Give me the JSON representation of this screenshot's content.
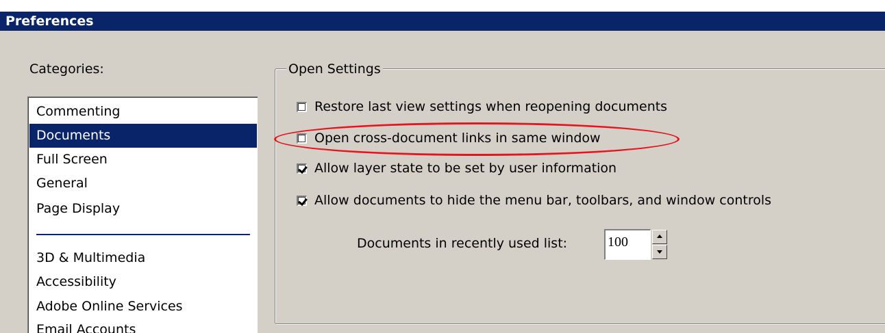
{
  "window": {
    "title": "Preferences"
  },
  "categories": {
    "label": "Categories:",
    "group1": [
      "Commenting",
      "Documents",
      "Full Screen",
      "General",
      "Page Display"
    ],
    "group2": [
      "3D & Multimedia",
      "Accessibility",
      "Adobe Online Services",
      "Email Accounts"
    ],
    "selected": "Documents"
  },
  "open_settings": {
    "legend": "Open Settings",
    "options": [
      {
        "label": "Restore last view settings when reopening documents",
        "checked": false
      },
      {
        "label": "Open cross-document links in same window",
        "checked": false,
        "highlighted": true
      },
      {
        "label": "Allow layer state to be set by user information",
        "checked": true
      },
      {
        "label": "Allow documents to hide the menu bar, toolbars, and window controls",
        "checked": true
      }
    ],
    "recent_list": {
      "label": "Documents in recently used list:",
      "value": "100"
    }
  },
  "colors": {
    "titlebar": "#0a246a",
    "selection": "#0a246a",
    "dialog_bg": "#d4d0c8",
    "highlight_ellipse": "#e8141c"
  }
}
